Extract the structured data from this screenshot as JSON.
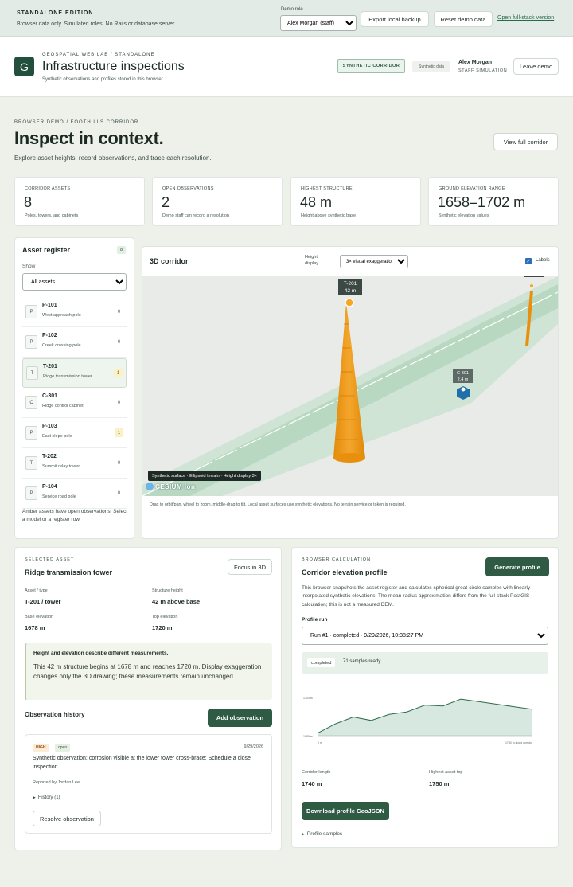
{
  "topbar": {
    "edition": "STANDALONE EDITION",
    "subtitle": "Browser data only. Simulated roles. No Rails or database server.",
    "role_label": "Demo role",
    "role_value": "Alex Morgan (staff)",
    "export_label": "Export local backup",
    "reset_label": "Reset demo data",
    "fullstack_link": "Open full-stack version"
  },
  "header": {
    "logo": "G",
    "overline": "GEOSPATIAL WEB LAB / STANDALONE",
    "title": "Infrastructure inspections",
    "subtitle": "Synthetic observations and profiles stored in this browser",
    "corridor_chip": "SYNTHETIC CORRIDOR",
    "data_chip": "Synthetic data",
    "user_name": "Alex Morgan",
    "user_role": "STAFF SIMULATION",
    "leave_label": "Leave demo"
  },
  "hero": {
    "breadcrumb": "BROWSER DEMO / FOOTHILLS CORRIDOR",
    "title": "Inspect in context.",
    "subtitle": "Explore asset heights, record observations, and trace each resolution.",
    "view_full_label": "View full corridor"
  },
  "stats": [
    {
      "label": "CORRIDOR ASSETS",
      "value": "8",
      "note": "Poles, towers, and cabinets"
    },
    {
      "label": "OPEN OBSERVATIONS",
      "value": "2",
      "note": "Demo staff can record a resolution"
    },
    {
      "label": "HIGHEST STRUCTURE",
      "value": "48 m",
      "note": "Height above synthetic base"
    },
    {
      "label": "GROUND ELEVATION RANGE",
      "value": "1658–1702 m",
      "note": "Synthetic elevation values"
    }
  ],
  "register": {
    "title": "Asset register",
    "count": "8",
    "show_label": "Show",
    "filter_value": "All assets",
    "items": [
      {
        "type": "P",
        "id": "P-101",
        "desc": "West approach pole",
        "count": "0"
      },
      {
        "type": "P",
        "id": "P-102",
        "desc": "Creek crossing pole",
        "count": "0"
      },
      {
        "type": "T",
        "id": "T-201",
        "desc": "Ridge transmission tower",
        "count": "1"
      },
      {
        "type": "C",
        "id": "C-301",
        "desc": "Ridge control cabinet",
        "count": "0"
      },
      {
        "type": "P",
        "id": "P-103",
        "desc": "East slope pole",
        "count": "1"
      },
      {
        "type": "T",
        "id": "T-202",
        "desc": "Summit relay tower",
        "count": "0"
      },
      {
        "type": "P",
        "id": "P-104",
        "desc": "Service road pole",
        "count": "0"
      }
    ],
    "footer": "Amber assets have open observations. Select a model or a register row."
  },
  "viewer": {
    "title": "3D corridor",
    "height_label": "Height display",
    "height_value": "3× visual exaggeration",
    "labels_label": "Labels",
    "tower_label_id": "T-201",
    "tower_label_h": "42 m",
    "cabinet_label_id": "C-301",
    "cabinet_label_h": "2.4 m",
    "surface_caption": "Synthetic surface · Ellipsoid terrain · Height display 3×",
    "cesium": "CESIUM ion",
    "hint": "Drag to orbit/pan, wheel to zoom, middle-drag to tilt. Local asset surfaces use synthetic elevations. No terrain service or token is required."
  },
  "selected": {
    "overline": "SELECTED ASSET",
    "title": "Ridge transmission tower",
    "focus_label": "Focus in 3D",
    "asset_type_label": "Asset / type",
    "asset_type_value": "T-201 / tower",
    "structure_height_label": "Structure height",
    "structure_height_value": "42 m above base",
    "base_elev_label": "Base elevation",
    "base_elev_value": "1678 m",
    "top_elev_label": "Top elevation",
    "top_elev_value": "1720 m",
    "note_title": "Height and elevation describe different measurements.",
    "note_body": "This 42 m structure begins at 1678 m and reaches 1720 m. Display exaggeration changes only the 3D drawing; these measurements remain unchanged.",
    "history_title": "Observation history",
    "add_obs_label": "Add observation",
    "obs": {
      "severity": "HIGH",
      "status": "open",
      "date": "9/29/2026",
      "text": "Synthetic observation: corrosion visible at the lower tower cross-brace: Schedule a close inspection.",
      "reporter": "Reported by Jordan Lee",
      "history": "History (1)",
      "resolve_label": "Resolve observation"
    }
  },
  "profile": {
    "overline": "BROWSER CALCULATION",
    "title": "Corridor elevation profile",
    "generate_label": "Generate profile",
    "description": "This browser snapshots the asset register and calculates spherical great-circle samples with linearly interpolated synthetic elevations. The mean-radius approximation differs from the full-stack PostGIS calculation; this is not a measured DEM.",
    "run_label": "Profile run",
    "run_value": "Run #1 · completed · 9/29/2026, 10:38:27 PM",
    "status": "completed",
    "samples_ready": "71 samples ready",
    "corridor_length_label": "Corridor length",
    "corridor_length_value": "1740 m",
    "highest_top_label": "Highest asset top",
    "highest_top_value": "1750 m",
    "download_label": "Download profile GeoJSON",
    "samples_label": "Profile samples"
  },
  "chart_data": {
    "type": "area",
    "title": "",
    "xlabel": "",
    "ylabel": "",
    "y_tick_labels": [
      "1703 m",
      "1658 m"
    ],
    "x_tick_labels": [
      "0 m",
      "1740 m along corridor"
    ],
    "x": [
      0,
      145,
      290,
      435,
      580,
      725,
      870,
      1015,
      1160,
      1305,
      1450,
      1595,
      1740
    ],
    "series": [
      {
        "values": [
          1661,
          1672,
          1680,
          1676,
          1683,
          1686,
          1694,
          1693,
          1701,
          1698,
          1695,
          1692,
          1689
        ]
      }
    ],
    "ylim": [
      1658,
      1703
    ],
    "xlim": [
      0,
      1740
    ],
    "grid": false,
    "fill_color": "#d6e8df",
    "line_color": "#2f6a4c"
  }
}
